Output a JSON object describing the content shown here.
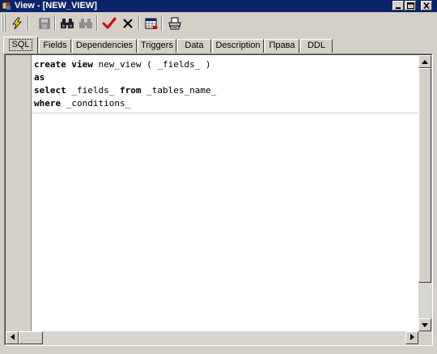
{
  "window": {
    "title": "View - [NEW_VIEW]"
  },
  "toolbar": {
    "buttons": [
      {
        "name": "compile",
        "icon": "lightning-icon"
      },
      {
        "name": "save",
        "icon": "floppy-disk-icon"
      },
      {
        "name": "find",
        "icon": "binoculars-icon"
      },
      {
        "name": "find-next",
        "icon": "binoculars-next-icon"
      },
      {
        "name": "commit",
        "icon": "checkmark-icon"
      },
      {
        "name": "rollback",
        "icon": "x-mark-icon"
      },
      {
        "name": "properties",
        "icon": "grid-window-icon"
      },
      {
        "name": "print",
        "icon": "printer-icon"
      }
    ]
  },
  "tabs": [
    {
      "label": "SQL",
      "active": true
    },
    {
      "label": "Fields"
    },
    {
      "label": "Dependencies"
    },
    {
      "label": "Triggers"
    },
    {
      "label": "Data"
    },
    {
      "label": "Description"
    },
    {
      "label": "Права"
    },
    {
      "label": "DDL"
    }
  ],
  "editor": {
    "lines": [
      [
        {
          "t": "create view",
          "kw": true
        },
        {
          "t": " new_view ( _fields_ )",
          "kw": false
        }
      ],
      [
        {
          "t": "as",
          "kw": true
        }
      ],
      [
        {
          "t": "select",
          "kw": true
        },
        {
          "t": " _fields_ ",
          "kw": false
        },
        {
          "t": "from",
          "kw": true
        },
        {
          "t": " _tables_name_",
          "kw": false
        }
      ],
      [
        {
          "t": "where",
          "kw": true
        },
        {
          "t": " _conditions_",
          "kw": false
        }
      ]
    ]
  },
  "colors": {
    "titlebar": "#0a246a",
    "face": "#d4d0c8",
    "check": "#d40000"
  }
}
